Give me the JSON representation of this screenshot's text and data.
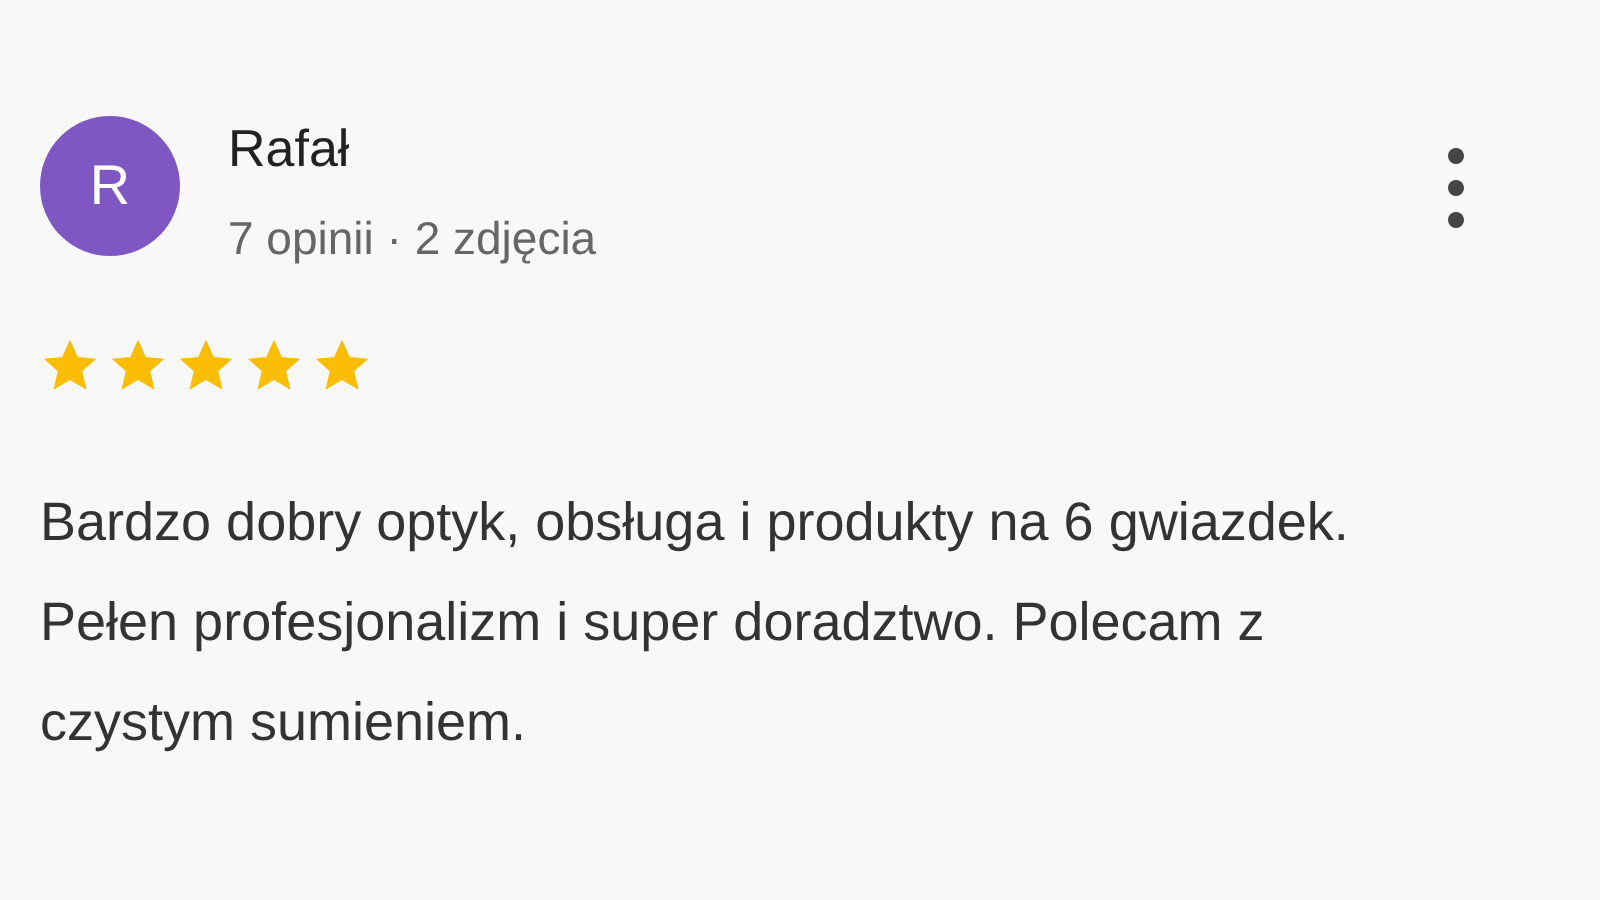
{
  "review": {
    "avatar_letter": "R",
    "author": "Rafał",
    "meta": "7 opinii · 2 zdjęcia",
    "stars": 5,
    "text": "Bardzo dobry optyk, obsługa i produkty na 6 gwiazdek. Pełen profesjonalizm i super doradztwo. Polecam z czystym sumieniem."
  }
}
